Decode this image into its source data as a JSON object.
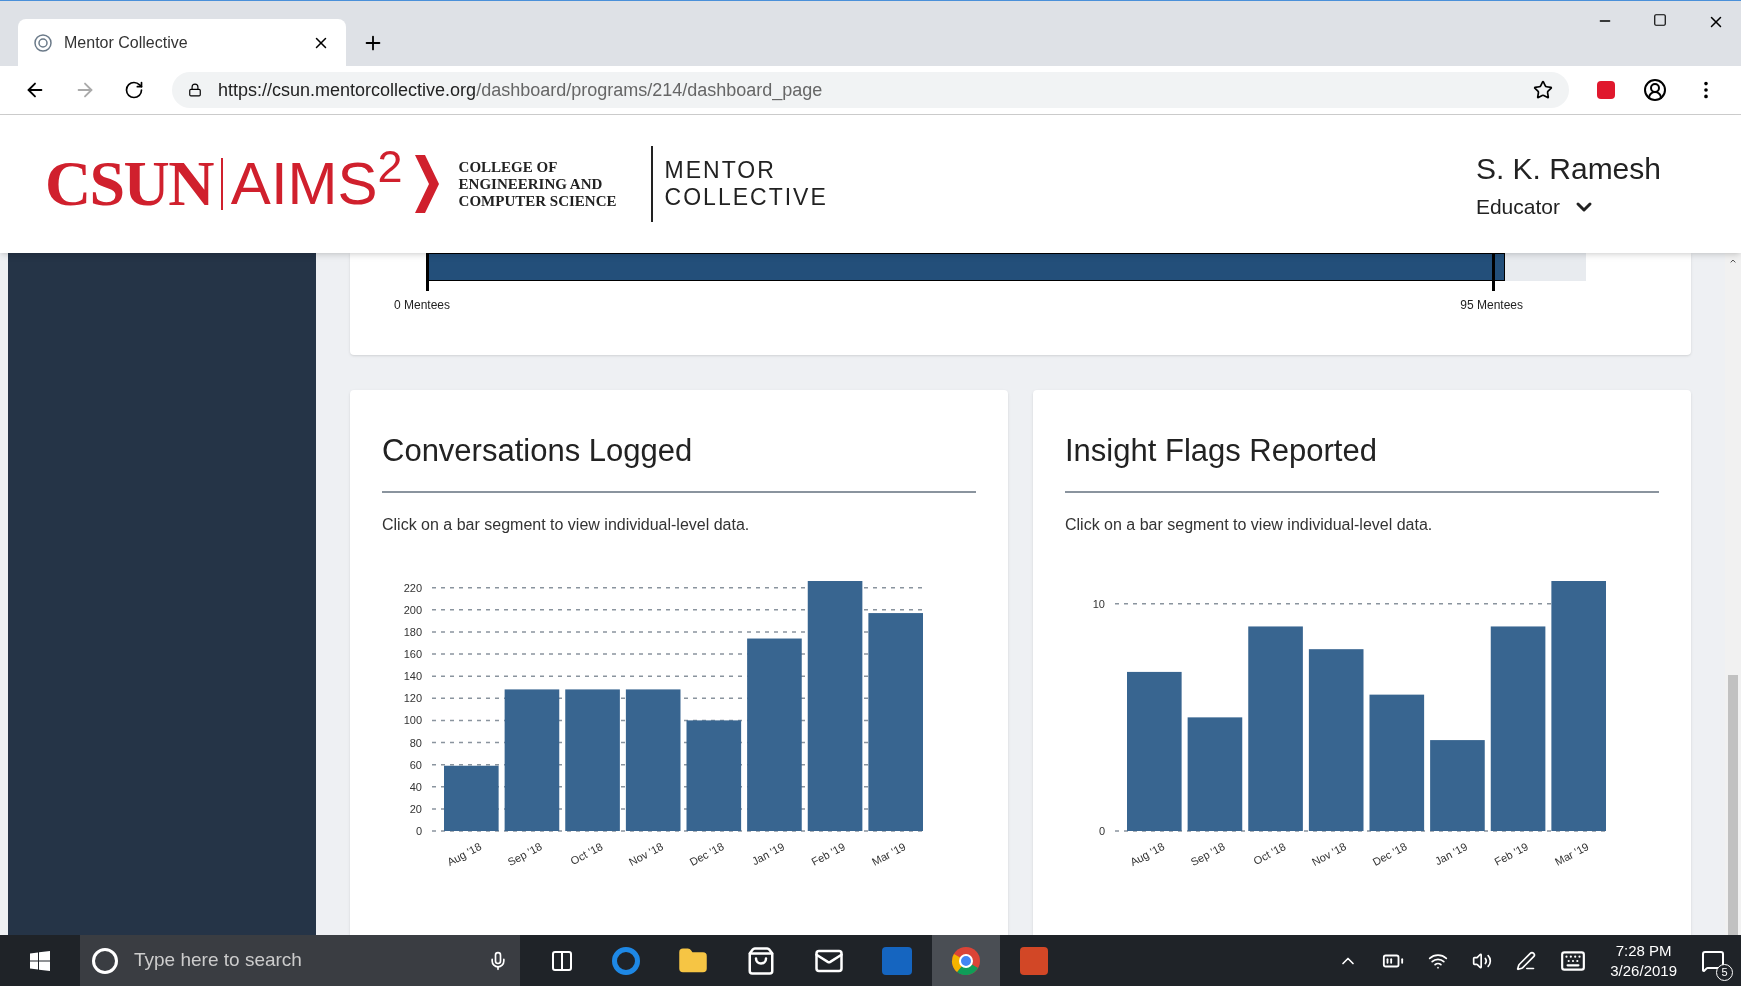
{
  "browser": {
    "tab": {
      "title": "Mentor Collective"
    },
    "url": {
      "host": "https://csun.mentorcollective.org",
      "path": "/dashboard/programs/214/dashboard_page"
    }
  },
  "header": {
    "logo_csun": "CSUN",
    "logo_aims": "AIMS$^{2}$",
    "college": "COLLEGE OF ENGINEERING AND COMPUTER SCIENCE",
    "brand_line_1": "MENTOR",
    "brand_line_2": "COLLECTIVE",
    "user_name": "S. K. Ramesh",
    "role": "Educator"
  },
  "progress": {
    "level": 0.93,
    "start_label": "0 Mentees",
    "end_label": "95 Mentees"
  },
  "cards": [
    {
      "title": "Conversations Logged",
      "hint": "Click on a bar segment to view individual-level data.",
      "chart_data": {
        "type": "bar",
        "categories": [
          "Aug '18",
          "Sep '18",
          "Oct '18",
          "Nov '18",
          "Dec '18",
          "Jan '19",
          "Feb '19",
          "Mar '19"
        ],
        "series": [
          {
            "color": "#386590",
            "values": [
              59,
              128,
              128,
              128,
              100,
              174,
              226,
              197
            ]
          }
        ],
        "grid": true,
        "ylim": [
          0,
          226
        ],
        "yticks": [
          0,
          20,
          40,
          60,
          80,
          100,
          120,
          140,
          160,
          180,
          200,
          220
        ]
      }
    },
    {
      "title": "Insight Flags Reported",
      "hint": "Click on a bar segment to view individual-level data.",
      "chart_data": {
        "type": "bar",
        "categories": [
          "Aug '18",
          "Sep '18",
          "Oct '18",
          "Nov '18",
          "Dec '18",
          "Jan '19",
          "Feb '19",
          "Mar '19"
        ],
        "series": [
          {
            "color": "#386590",
            "values": [
              7,
              5,
              9,
              8,
              6,
              4,
              9,
              11
            ]
          }
        ],
        "grid": true,
        "ylim": [
          0,
          11
        ],
        "yticks": [
          0,
          10
        ]
      }
    }
  ],
  "taskbar": {
    "search_placeholder": "Type here to search",
    "time": "7:28 PM",
    "date": "3/26/2019",
    "notification_count": "5"
  }
}
